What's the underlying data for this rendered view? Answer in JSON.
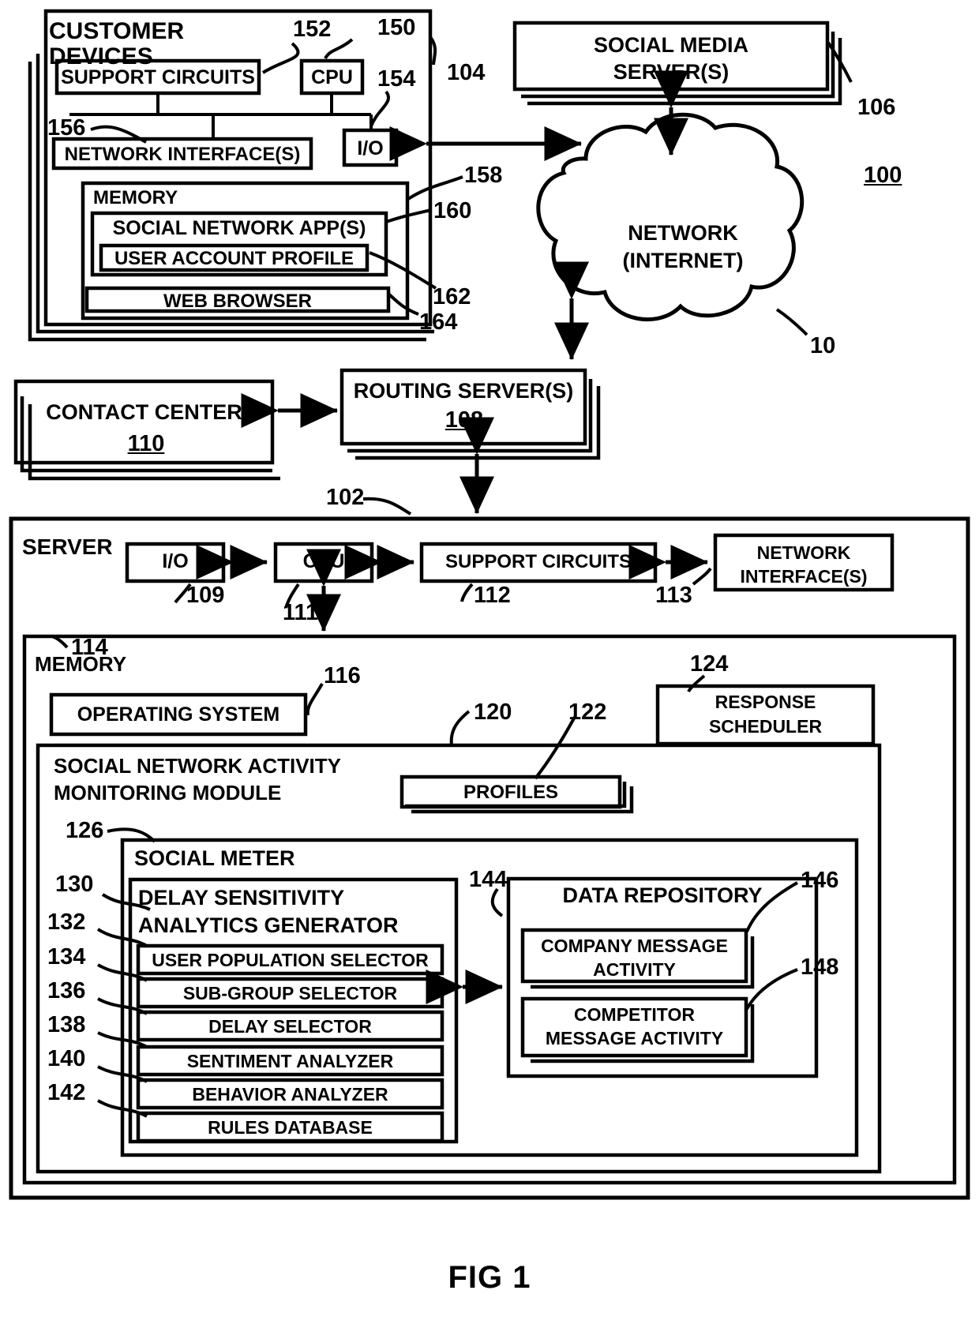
{
  "figure": {
    "caption": "FIG 1",
    "system_ref": "100"
  },
  "blocks": {
    "customer_devices": {
      "label": "CUSTOMER  DEVICES",
      "ref": "104"
    },
    "support_circuits_cd": {
      "label": "SUPPORT CIRCUITS",
      "ref": "152"
    },
    "cpu_cd": {
      "label": "CPU",
      "ref": "150"
    },
    "io_cd": {
      "label": "I/O",
      "ref": "154"
    },
    "network_interfaces_cd": {
      "label": "NETWORK INTERFACE(S)",
      "ref": "156"
    },
    "memory_cd": {
      "label": "MEMORY",
      "ref": "158"
    },
    "social_network_apps": {
      "label": "SOCIAL NETWORK APP(S)",
      "ref": "160"
    },
    "user_account_profile": {
      "label": "USER ACCOUNT PROFILE",
      "ref": "162"
    },
    "web_browser": {
      "label": "WEB BROWSER",
      "ref": "164"
    },
    "social_media_servers": {
      "label": "SOCIAL MEDIA\nSERVER(S)",
      "ref": "106"
    },
    "network_cloud": {
      "label": "NETWORK\n(INTERNET)",
      "ref": "10"
    },
    "contact_center": {
      "label": "CONTACT CENTER",
      "ref": "110"
    },
    "routing_servers": {
      "label": "ROUTING SERVER(S)",
      "ref": "108"
    },
    "server": {
      "label": "SERVER",
      "ref": "102"
    },
    "io_srv": {
      "label": "I/O",
      "ref": "109"
    },
    "cpu_srv": {
      "label": "CPU",
      "ref": "111"
    },
    "support_circuits_srv": {
      "label": "SUPPORT CIRCUITS",
      "ref": "112"
    },
    "network_interfaces_srv": {
      "label": "NETWORK\nINTERFACE(S)",
      "ref": "113"
    },
    "memory_srv": {
      "label": "MEMORY",
      "ref": "114"
    },
    "operating_system": {
      "label": "OPERATING SYSTEM",
      "ref": "116"
    },
    "response_scheduler": {
      "label": "RESPONSE\nSCHEDULER",
      "ref": "124"
    },
    "monitoring_module": {
      "label": "SOCIAL NETWORK ACTIVITY\nMONITORING MODULE",
      "ref": "120"
    },
    "profiles": {
      "label": "PROFILES",
      "ref": "122"
    },
    "social_meter": {
      "label": "SOCIAL METER",
      "ref": "126"
    },
    "delay_sensitivity_generator": {
      "label": "DELAY SENSITIVITY\nANALYTICS GENERATOR",
      "ref": "130"
    },
    "user_population_selector": {
      "label": "USER POPULATION SELECTOR",
      "ref": "132"
    },
    "sub_group_selector": {
      "label": "SUB-GROUP SELECTOR",
      "ref": "134"
    },
    "delay_selector": {
      "label": "DELAY SELECTOR",
      "ref": "136"
    },
    "sentiment_analyzer": {
      "label": "SENTIMENT ANALYZER",
      "ref": "138"
    },
    "behavior_analyzer": {
      "label": "BEHAVIOR ANALYZER",
      "ref": "140"
    },
    "rules_database": {
      "label": "RULES DATABASE",
      "ref": "142"
    },
    "data_repository": {
      "label": "DATA REPOSITORY",
      "ref": "144"
    },
    "company_message_activity": {
      "label": "COMPANY MESSAGE\nACTIVITY",
      "ref": "146"
    },
    "competitor_message_activity": {
      "label": "COMPETITOR\nMESSAGE ACTIVITY",
      "ref": "148"
    }
  }
}
